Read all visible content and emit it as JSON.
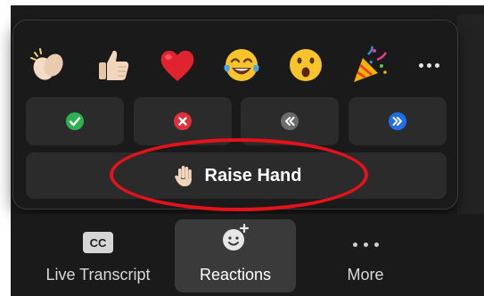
{
  "reactions_panel": {
    "emojis": [
      {
        "name": "clapping-hands",
        "glyph": "clap"
      },
      {
        "name": "thumbs-up",
        "glyph": "thumb"
      },
      {
        "name": "heart",
        "glyph": "heart"
      },
      {
        "name": "tears-of-joy",
        "glyph": "joy"
      },
      {
        "name": "open-mouth",
        "glyph": "wow"
      },
      {
        "name": "party-popper",
        "glyph": "tada"
      }
    ],
    "more_icon": "ellipsis-icon",
    "actions": [
      {
        "name": "yes",
        "icon": "checkmark-icon",
        "color": "#2eb24f"
      },
      {
        "name": "no",
        "icon": "x-icon",
        "color": "#e0313b"
      },
      {
        "name": "slow-down",
        "icon": "rewind-icon",
        "color": "#6c6c6c"
      },
      {
        "name": "speed-up",
        "icon": "fast-forward-icon",
        "color": "#1f6fe8"
      }
    ],
    "raise_hand_label": "Raise Hand"
  },
  "toolbar": {
    "transcript_badge": "CC",
    "transcript_label": "Live Transcript",
    "reactions_label": "Reactions",
    "more_label": "More"
  },
  "annotation": {
    "color": "#e3121b"
  }
}
